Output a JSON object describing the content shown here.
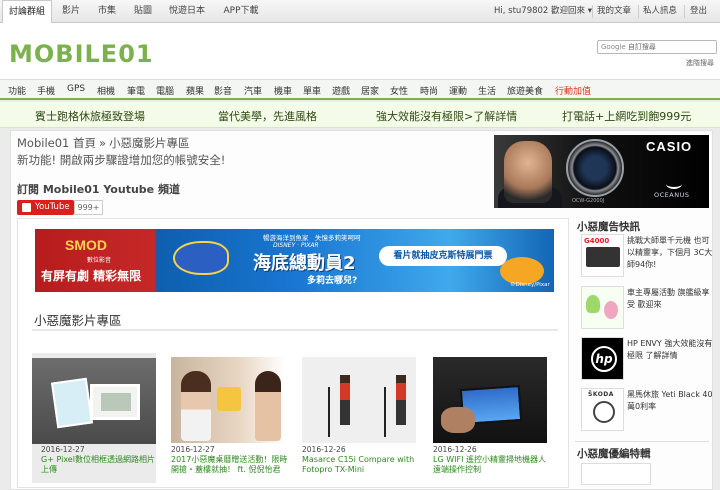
{
  "topbar": {
    "tabs": [
      "討論群組",
      "影片",
      "市集",
      "貼圖",
      "悅遊日本",
      "APP下載"
    ],
    "greeting": "Hi, stu79802 歡迎回來",
    "greeting_caret": "▾",
    "links": [
      "我的文章",
      "私人訊息",
      "登出"
    ]
  },
  "header": {
    "logo": "MOBILE01",
    "search_brand": "Google",
    "search_placeholder": "自訂搜尋",
    "advanced_search": "進階搜尋"
  },
  "nav": {
    "items": [
      "功能",
      "手機",
      "GPS",
      "相機",
      "筆電",
      "電腦",
      "蘋果",
      "影音",
      "汽車",
      "機車",
      "單車",
      "遊戲",
      "居家",
      "女性",
      "時尚",
      "運動",
      "生活",
      "旅遊美食",
      "行動加值"
    ]
  },
  "promo": {
    "links": [
      "賓士跑格休旅極致登場",
      "當代美學，先進風格",
      "強大效能沒有極限>了解詳情",
      "打電話+上網吃到飽999元"
    ]
  },
  "breadcrumb": {
    "home": "Mobile01 首頁",
    "separator": "»",
    "current": "小惡魔影片專區"
  },
  "notice": "新功能! 開啟兩步驟證增加您的帳號安全!",
  "casio_ad": {
    "brand": "CASIO",
    "product": "OCEANUS",
    "model": "OCW-G2000J"
  },
  "subscribe": {
    "title": "訂閱 Mobile01 Youtube 頻道",
    "button": "YouTube",
    "count": "999+"
  },
  "banner": {
    "brand": "SMOD",
    "brand_sub": "數位影音",
    "slogan": "有屏有劇 精彩無限",
    "tagline": "暢游海洋到魚家　失憶多莉笑呵呵",
    "studio": "DISNEY · PIXAR",
    "title": "海底總動員2",
    "question": "多莉去哪兒?",
    "cta": "看片就抽皮克斯特展門票",
    "copyright": "©Disney/Pixar"
  },
  "section": {
    "title": "小惡魔影片專區"
  },
  "videos": [
    {
      "date": "2016-12-27",
      "title": "G+ Pixel數位相框透過網路相片上傳"
    },
    {
      "date": "2016-12-27",
      "title": "2017小惡魔桌曆贈送活動！限時開搶・蓋樓就抽！ ft. 倪倪怡君"
    },
    {
      "date": "2016-12-26",
      "title": "Masarce C15i Compare with Fotopro TX-Mini"
    },
    {
      "date": "2016-12-26",
      "title": "LG WIFI 遙控小精靈掃地機器人遠端操作控制"
    }
  ],
  "sidebar": {
    "title": "小惡魔告快訊",
    "items": [
      {
        "icon_label": "G4000",
        "text": "挑戰大師單千元機 也可以精靈享，下個月 3C大師94你!"
      },
      {
        "icon_label": "",
        "text": "車主專屬活動 旗艦級享受 歡迎來"
      },
      {
        "icon_label": "hp",
        "text": "HP ENVY 強大效能沒有極限 了解詳情"
      },
      {
        "icon_label": "ŠKODA",
        "text": "黑馬休旅 Yeti Black 40萬0利率"
      }
    ],
    "title2": "小惡魔優編特輯"
  },
  "colors": {
    "accent_green": "#7bb24d",
    "link_green": "#2d8a1e",
    "youtube_red": "#d9201d",
    "hot_red": "#e0301e"
  }
}
